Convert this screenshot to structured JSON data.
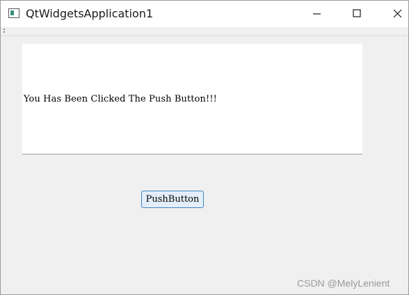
{
  "window": {
    "title": "QtWidgetsApplication1",
    "icon": "window-app-icon"
  },
  "caption_buttons": {
    "minimize_icon": "minimize-icon",
    "maximize_icon": "maximize-icon",
    "close_icon": "close-icon"
  },
  "main": {
    "message": "You Has Been Clicked The Push Button!!!",
    "push_button_label": "PushButton"
  },
  "watermark": {
    "text": "CSDN @MelyLenient"
  },
  "colors": {
    "window_bg": "#f0f0f0",
    "titlebar_bg": "#ffffff",
    "button_border": "#3e83c2",
    "button_bg": "#e4eefa"
  }
}
